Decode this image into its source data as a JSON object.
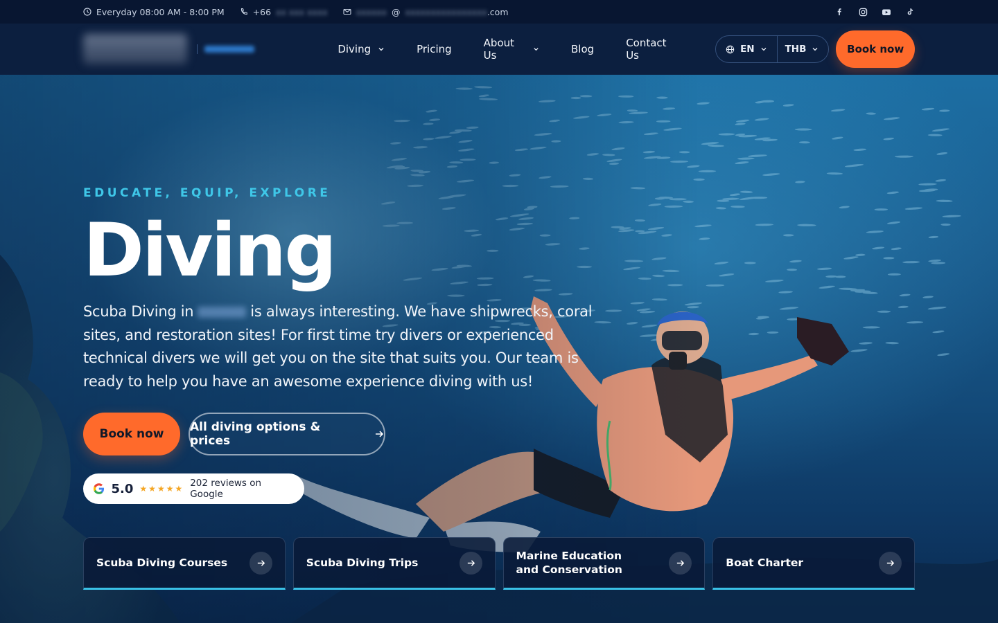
{
  "topbar": {
    "hours": "Everyday 08:00 AM - 8:00 PM",
    "phone_prefix": "+66",
    "email_at": "@",
    "email_suffix": ".com",
    "social": [
      "facebook-icon",
      "instagram-icon",
      "youtube-icon",
      "tiktok-icon"
    ]
  },
  "nav": {
    "items": [
      {
        "label": "Diving",
        "dropdown": true
      },
      {
        "label": "Pricing",
        "dropdown": false
      },
      {
        "label": "About Us",
        "dropdown": true
      },
      {
        "label": "Blog",
        "dropdown": false
      },
      {
        "label": "Contact Us",
        "dropdown": false
      }
    ],
    "language": "EN",
    "currency": "THB",
    "book_label": "Book now"
  },
  "hero": {
    "eyebrow": "EDUCATE, EQUIP, EXPLORE",
    "title": "Diving",
    "desc_before": "Scuba Diving in",
    "desc_after": "is always interesting. We have shipwrecks, coral sites, and restoration sites! For first time try divers or experienced technical divers we will get you on the site that suits you. Our team is ready to help you have an awesome experience diving with us!",
    "book_label": "Book now",
    "options_label": "All diving options & prices"
  },
  "reviews": {
    "rating": "5.0",
    "stars": "★★★★★",
    "text": "202 reviews on Google"
  },
  "cards": [
    {
      "label": "Scuba Diving Courses"
    },
    {
      "label": "Scuba Diving Trips"
    },
    {
      "label": "Marine Education and Conservation"
    },
    {
      "label": "Boat Charter"
    }
  ],
  "colors": {
    "accent": "#ff6a2b",
    "eyebrow": "#3fc7e8",
    "nav_bg": "#0c1f3f",
    "topbar_bg": "#081631"
  }
}
